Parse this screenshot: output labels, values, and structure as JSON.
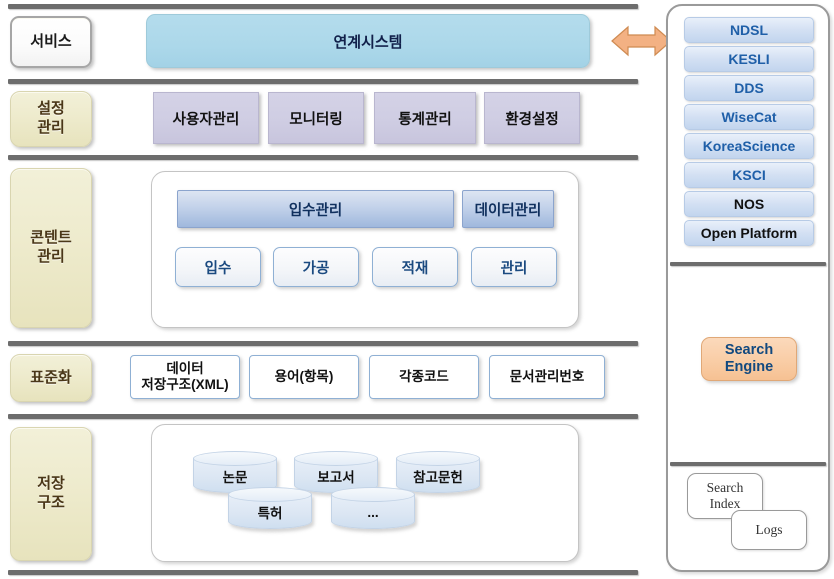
{
  "diagram": {
    "title": "System Architecture Layers",
    "colors": {
      "divider": "#6d6d6d",
      "category": "#efecd2",
      "link_system": "#add8e8",
      "settings_button": "#cfcde3",
      "content_header": "#9fb8dd",
      "search_engine": "#f9cda6",
      "cylinder": "#d9e4f2"
    }
  },
  "layers": [
    {
      "label": "서비스",
      "style": "white",
      "items": [
        {
          "label": "연계시스템",
          "type": "link-system-bar"
        }
      ]
    },
    {
      "label": "설정\n관리",
      "label_lines": [
        "설정",
        "관리"
      ],
      "style": "cream",
      "items": [
        {
          "label": "사용자관리"
        },
        {
          "label": "모니터링"
        },
        {
          "label": "통계관리"
        },
        {
          "label": "환경설정"
        }
      ]
    },
    {
      "label_lines": [
        "콘텐트",
        "관리"
      ],
      "style": "cream",
      "headers": [
        {
          "label": "입수관리"
        },
        {
          "label": "데이터관리"
        }
      ],
      "steps": [
        {
          "label": "입수"
        },
        {
          "label": "가공"
        },
        {
          "label": "적재"
        },
        {
          "label": "관리"
        }
      ],
      "flow_arrows": 3
    },
    {
      "label_lines": [
        "표준화"
      ],
      "style": "cream",
      "items": [
        {
          "label_lines": [
            "데이터",
            "저장구조(XML)"
          ]
        },
        {
          "label_lines": [
            "용어(항목)"
          ]
        },
        {
          "label_lines": [
            "각종코드"
          ]
        },
        {
          "label_lines": [
            "문서관리번호"
          ]
        }
      ]
    },
    {
      "label_lines": [
        "저장",
        "구조"
      ],
      "style": "cream",
      "stores": [
        {
          "label": "논문"
        },
        {
          "label": "보고서"
        },
        {
          "label": "참고문헌"
        },
        {
          "label": "특허"
        },
        {
          "label": "..."
        }
      ]
    }
  ],
  "connector": {
    "icon": "double-headed-arrow",
    "color": "#f3b183"
  },
  "right_panel": {
    "services": [
      {
        "label": "NDSL",
        "emphasis": "blue"
      },
      {
        "label": "KESLI",
        "emphasis": "blue"
      },
      {
        "label": "DDS",
        "emphasis": "blue"
      },
      {
        "label": "WiseCat",
        "emphasis": "blue"
      },
      {
        "label": "KoreaScience",
        "emphasis": "blue"
      },
      {
        "label": "KSCI",
        "emphasis": "blue"
      },
      {
        "label": "NOS",
        "emphasis": "dark"
      },
      {
        "label": "Open Platform",
        "emphasis": "dark"
      }
    ],
    "engine": {
      "label_lines": [
        "Search",
        "Engine"
      ]
    },
    "storage": [
      {
        "label_lines": [
          "Search",
          "Index"
        ]
      },
      {
        "label_lines": [
          "Logs"
        ]
      }
    ]
  }
}
